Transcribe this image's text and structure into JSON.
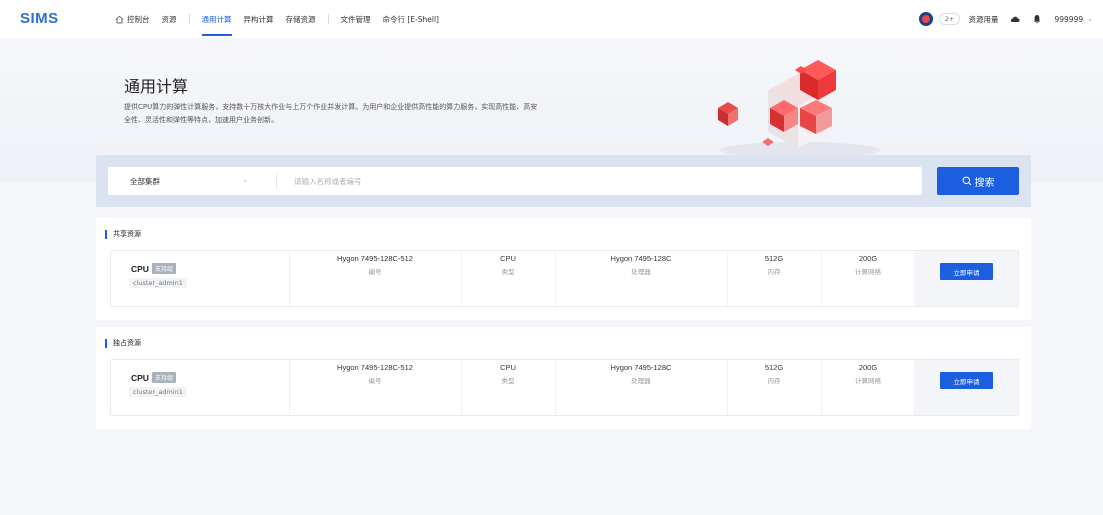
{
  "app": {
    "logo": "SIMS"
  },
  "nav": {
    "items": [
      {
        "label": "控制台",
        "icon": "home-icon"
      },
      {
        "label": "资源"
      },
      {
        "label": "通用计算",
        "active": true
      },
      {
        "label": "异构计算"
      },
      {
        "label": "存储资源"
      },
      {
        "label": "文件管理"
      },
      {
        "label": "命令行 [E-Shell]"
      }
    ]
  },
  "header_tools": {
    "badge_count": "2+",
    "usage_label": "资源用量",
    "username": "999999",
    "icons": [
      "avatar",
      "cloud-icon",
      "bell-icon",
      "chevron-down-icon"
    ]
  },
  "hero": {
    "title": "通用计算",
    "desc_line1": "提供CPU算力的弹性计算服务，支持数十万核大作业与上万个作业并发计算。为用户和企业提供高性能的算力服务，实现高性能、高安",
    "desc_line2": "全性、灵活性和弹性等特点，加速用户业务创新。"
  },
  "search": {
    "cluster_value": "全部集群",
    "keyword_placeholder": "请输入名称或者编号",
    "button_label": "搜索"
  },
  "sections": [
    {
      "title": "共享资源",
      "resource": {
        "type": "CPU",
        "tag": "支持组",
        "cluster": "cluster_admin1",
        "code_value": "Hygon 7495-128C-512",
        "code_key": "编号",
        "kind_value": "CPU",
        "kind_key": "类型",
        "cpu_value": "Hygon 7495-128C",
        "cpu_key": "处理器",
        "mem_value": "512G",
        "mem_key": "内存",
        "net_value": "200G",
        "net_key": "计算网络",
        "apply_label": "立即申请"
      }
    },
    {
      "title": "独占资源",
      "resource": {
        "type": "CPU",
        "tag": "支持组",
        "cluster": "cluster_admin1",
        "code_value": "Hygon 7495-128C-512",
        "code_key": "编号",
        "kind_value": "CPU",
        "kind_key": "类型",
        "cpu_value": "Hygon 7495-128C",
        "cpu_key": "处理器",
        "mem_value": "512G",
        "mem_key": "内存",
        "net_value": "200G",
        "net_key": "计算网络",
        "apply_label": "立即申请"
      }
    }
  ],
  "colors": {
    "primary": "#1b5fe0",
    "logo": "#2b6fd6",
    "accent_red": "#e84545"
  }
}
